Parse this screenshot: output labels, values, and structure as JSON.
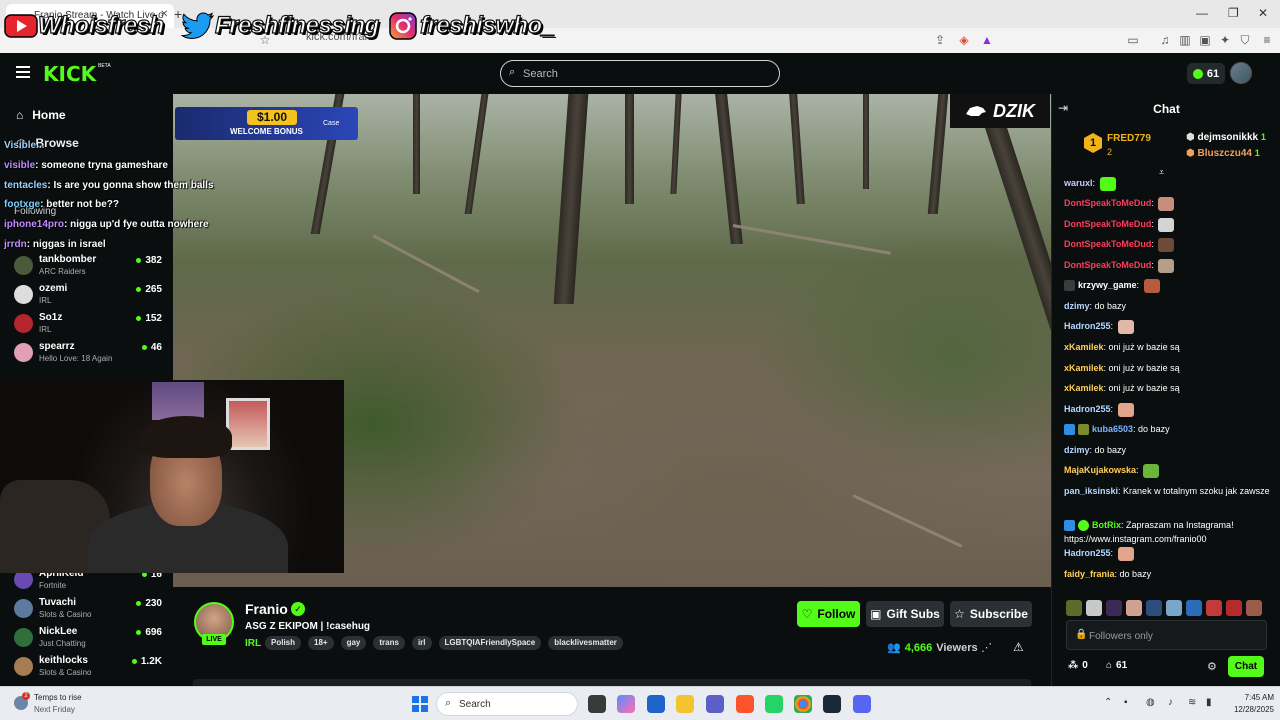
{
  "browser": {
    "tab_title": "Franio Stream - Watch Live o",
    "url": "kick.com/frani"
  },
  "overlay": {
    "socials": [
      {
        "icon": "youtube-icon",
        "handle": "Whoisfresh"
      },
      {
        "icon": "twitter-icon",
        "handle": "Freshfinessing"
      },
      {
        "icon": "instagram-icon",
        "handle": "freshiswho_"
      }
    ],
    "promo_amount": "$1.00",
    "promo_text": "WELCOME BONUS",
    "promo_brand": "Case",
    "brand_logo": "DZIK",
    "chat_lines": [
      {
        "user": "Visible...",
        "text": ""
      },
      {
        "user": "visible",
        "text": ": someone tryna gameshare"
      },
      {
        "user": "tentacles",
        "text": ": Is are you gonna show them balls"
      },
      {
        "user": "footxge",
        "text": ": better not be??"
      },
      {
        "user": "iphone14pro",
        "text": ": nigga up'd fye outta nowhere"
      },
      {
        "user": "jrrdn",
        "text": ": niggas in israel"
      }
    ]
  },
  "header": {
    "logo": "KICK",
    "logo_badge": "BETA",
    "search_placeholder": "Search",
    "kicks_count": "61"
  },
  "sidebar": {
    "home": "Home",
    "browse": "Browse",
    "following_label": "Following",
    "channels": [
      {
        "name": "tankbomber",
        "category": "ARC Raiders",
        "viewers": "382"
      },
      {
        "name": "ozemi",
        "category": "IRL",
        "viewers": "265"
      },
      {
        "name": "So1z",
        "category": "IRL",
        "viewers": "152"
      },
      {
        "name": "spearrz",
        "category": "Hello Love: 18 Again",
        "viewers": "46"
      },
      {
        "name": "AprilKeld",
        "category": "Fortnite",
        "viewers": "16"
      },
      {
        "name": "Tuvachi",
        "category": "Slots & Casino",
        "viewers": "230"
      },
      {
        "name": "NickLee",
        "category": "Just Chatting",
        "viewers": "696"
      },
      {
        "name": "keithlocks",
        "category": "Slots & Casino",
        "viewers": "1.2K"
      }
    ]
  },
  "stream": {
    "streamer": "Franio",
    "live_label": "LIVE",
    "title": "ASG Z EKIPOM  | !casehug",
    "category": "IRL",
    "tags": [
      "Polish",
      "18+",
      "gay",
      "trans",
      "irl",
      "LGBTQIAFriendlySpace",
      "blacklivesmatter"
    ],
    "follow_label": "Follow",
    "gift_label": "Gift Subs",
    "subscribe_label": "Subscribe",
    "viewers": "4,666",
    "viewers_label": "Viewers"
  },
  "chat": {
    "title": "Chat",
    "leaderboard": {
      "rank": "1",
      "top_name": "FRED779",
      "top_count": "2",
      "others": [
        {
          "name": "dejmsonikkk",
          "count": "1"
        },
        {
          "name": "Bluszczu44",
          "count": "1"
        }
      ]
    },
    "messages": [
      {
        "user": "waruxl",
        "text": "",
        "color": "#c9c9ff"
      },
      {
        "user": "DontSpeakToMeDud",
        "text": "",
        "color": "#ff3b5c"
      },
      {
        "user": "DontSpeakToMeDud",
        "text": "",
        "color": "#ff3b5c"
      },
      {
        "user": "DontSpeakToMeDud",
        "text": "",
        "color": "#ff3b5c"
      },
      {
        "user": "DontSpeakToMeDud",
        "text": "",
        "color": "#ff3b5c"
      },
      {
        "user": "krzywy_game",
        "text": "",
        "color": "#ffffff"
      },
      {
        "user": "dzimy",
        "text": "do bazy",
        "color": "#b5d8ff"
      },
      {
        "user": "Hadron255",
        "text": "",
        "color": "#b5d8ff"
      },
      {
        "user": "xKamilek",
        "text": "oni już w bazie są",
        "color": "#ffcf57"
      },
      {
        "user": "xKamilek",
        "text": "oni już w bazie są",
        "color": "#ffcf57"
      },
      {
        "user": "xKamilek",
        "text": "oni już w bazie są",
        "color": "#ffcf57"
      },
      {
        "user": "Hadron255",
        "text": "",
        "color": "#b5d8ff"
      },
      {
        "user": "kuba6503",
        "text": "do bazy",
        "color": "#7db3ff"
      },
      {
        "user": "dzimy",
        "text": "do bazy",
        "color": "#b5d8ff"
      },
      {
        "user": "MajaKujakowska",
        "text": "",
        "color": "#ffcf57"
      },
      {
        "user": "pan_iksinski",
        "text": "Kranek w totalnym szoku jak zawsze",
        "color": "#b5d8ff"
      },
      {
        "user": "BotRix",
        "text": "Zapraszam na Instagrama! https://www.instagram.com/franio00",
        "color": "#53fc18"
      },
      {
        "user": "Hadron255",
        "text": "",
        "color": "#b5d8ff"
      },
      {
        "user": "faidy_frania",
        "text": "do bazy",
        "color": "#ffcf57"
      }
    ],
    "input_placeholder": "Followers only",
    "points": "0",
    "kicks": "61",
    "send_label": "Chat"
  },
  "taskbar": {
    "weather_title": "Temps to rise",
    "weather_sub": "Next Friday",
    "weather_badge": "2",
    "search_placeholder": "Search",
    "time": "7:45 AM",
    "date": "12/28/2025"
  }
}
